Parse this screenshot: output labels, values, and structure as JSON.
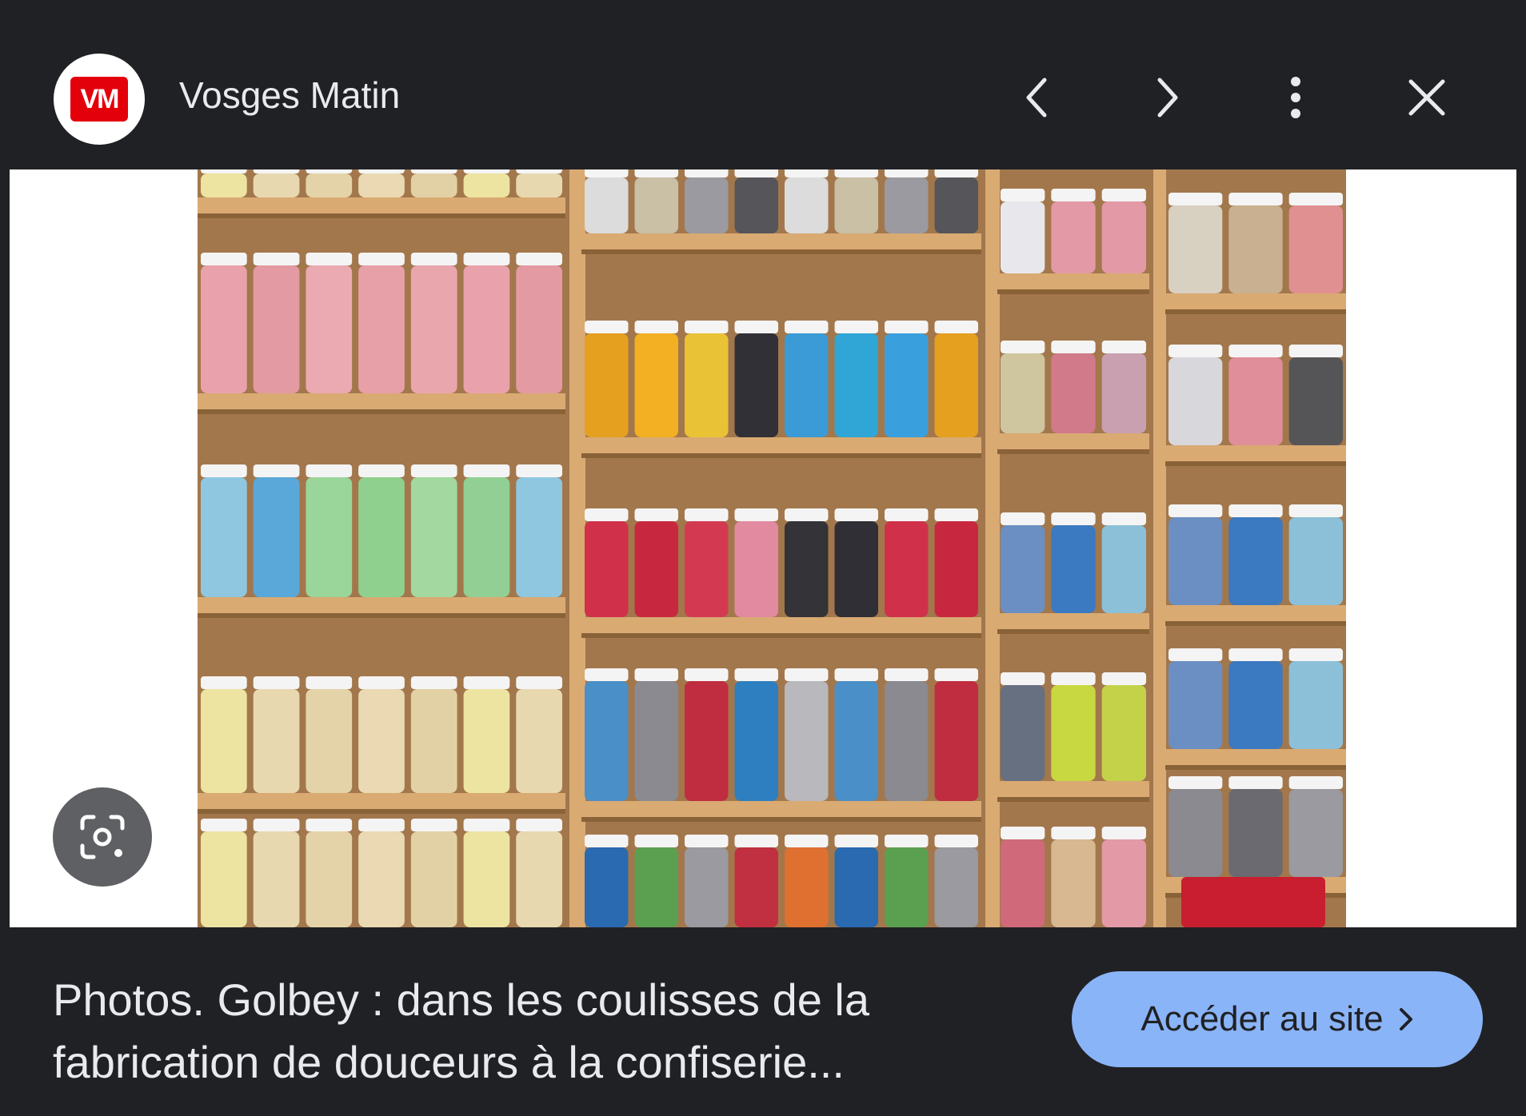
{
  "header": {
    "logo_text": "VM",
    "site_name": "Vosges Matin",
    "icons": [
      "chevron-left-icon",
      "chevron-right-icon",
      "more-vert-icon",
      "close-icon"
    ]
  },
  "image": {
    "subject": "photo"
  },
  "footer": {
    "caption": "Photos. Golbey : dans les coulisses de la fabrication de douceurs à la confiserie...",
    "visit_label": "Accéder au site",
    "visit_icon": "chevron-right-icon"
  },
  "colors": {
    "background": "#202124",
    "button": "#8ab4f8",
    "logo_red": "#e3000b"
  }
}
